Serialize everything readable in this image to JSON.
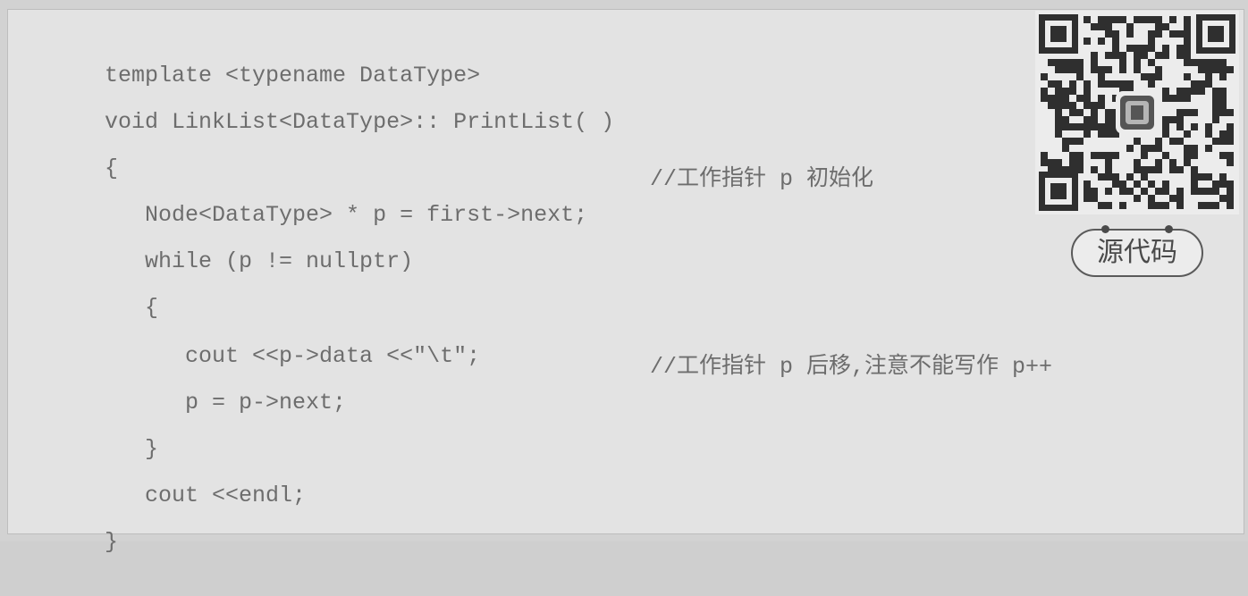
{
  "code": {
    "lines": [
      {
        "text": "template <typename DataType>",
        "comment": ""
      },
      {
        "text": "void LinkList<DataType>:: PrintList( )",
        "comment": ""
      },
      {
        "text": "{",
        "comment": ""
      },
      {
        "text": "   Node<DataType> * p = first->next;",
        "comment": "//工作指针 p 初始化"
      },
      {
        "text": "   while (p != nullptr)",
        "comment": ""
      },
      {
        "text": "   {",
        "comment": ""
      },
      {
        "text": "      cout <<p->data <<\"\\t\";",
        "comment": ""
      },
      {
        "text": "      p = p->next;",
        "comment": "//工作指针 p 后移,注意不能写作 p++"
      },
      {
        "text": "   }",
        "comment": ""
      },
      {
        "text": "   cout <<endl;",
        "comment": ""
      },
      {
        "text": "}",
        "comment": ""
      }
    ]
  },
  "badge": {
    "label": "源代码"
  },
  "qr": {
    "icon": "qr-code-icon",
    "logo_icon": "publisher-logo-icon"
  }
}
